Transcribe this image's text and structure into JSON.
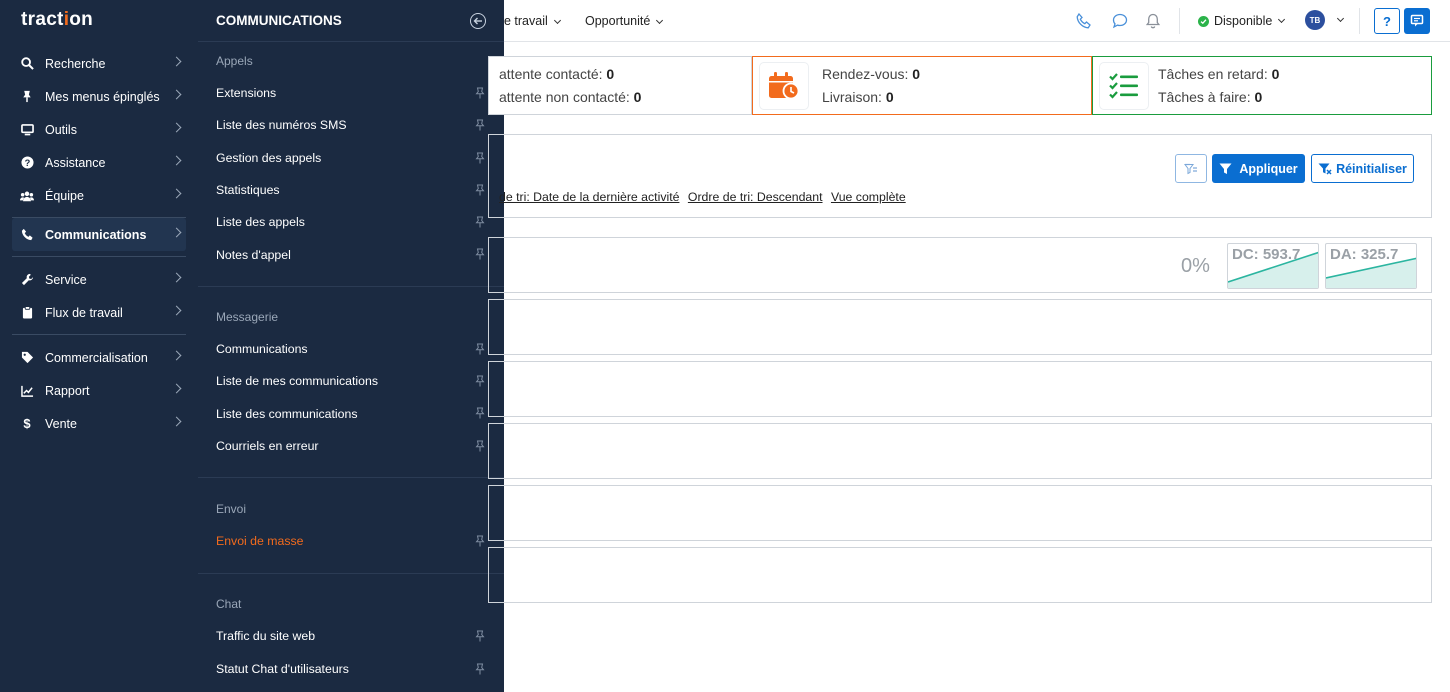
{
  "sidebar": {
    "logo_pre": "tract",
    "logo_dot": "i",
    "logo_post": "on",
    "items": [
      {
        "label": "Recherche",
        "icon": "search-icon"
      },
      {
        "label": "Mes menus épinglés",
        "icon": "pin-icon"
      },
      {
        "label": "Outils",
        "icon": "monitor-icon"
      },
      {
        "label": "Assistance",
        "icon": "help-circle-icon"
      },
      {
        "label": "Équipe",
        "icon": "team-icon"
      },
      {
        "label": "Communications",
        "icon": "phone-icon",
        "active": true
      },
      {
        "label": "Service",
        "icon": "wrench-icon"
      },
      {
        "label": "Flux de travail",
        "icon": "clipboard-icon"
      },
      {
        "label": "Commercialisation",
        "icon": "tag-icon"
      },
      {
        "label": "Rapport",
        "icon": "chart-line-icon"
      },
      {
        "label": "Vente",
        "icon": "dollar-icon"
      }
    ]
  },
  "flyout": {
    "title": "COMMUNICATIONS",
    "sections": [
      {
        "title": "Appels",
        "items": [
          "Extensions",
          "Liste des numéros SMS",
          "Gestion des appels",
          "Statistiques",
          "Liste des appels",
          "Notes d'appel"
        ]
      },
      {
        "title": "Messagerie",
        "items": [
          "Communications",
          "Liste de mes communications",
          "Liste des communications",
          "Courriels en erreur"
        ]
      },
      {
        "title": "Envoi",
        "items": [
          "Envoi de masse"
        ]
      },
      {
        "title": "Chat",
        "items": [
          "Traffic du site web",
          "Statut Chat d'utilisateurs"
        ]
      }
    ]
  },
  "topbar": {
    "menu_workflow": "e travail",
    "menu_opportunity": "Opportunité",
    "status": "Disponible",
    "help": "?",
    "avatar_initials": "TB"
  },
  "cards": {
    "c1_l1": "attente contacté:",
    "c1_v1": "0",
    "c1_l2": "attente non contacté:",
    "c1_v2": "0",
    "c2_l1": "Rendez-vous:",
    "c2_v1": "0",
    "c2_l2": "Livraison:",
    "c2_v2": "0",
    "c3_l1": "Tâches en retard:",
    "c3_v1": "0",
    "c3_l2": "Tâches à faire:",
    "c3_v2": "0"
  },
  "filters": {
    "apply": "Appliquer",
    "reset": "Réinitialiser",
    "sort_field": "de tri: Date de la dernière activité",
    "sort_order": "Ordre de tri: Descendant",
    "view": "Vue complète"
  },
  "stats": {
    "percent": "0%",
    "dc_label": "DC: 593.7",
    "da_label": "DA: 325.7"
  },
  "colors": {
    "sidebar_bg": "#1b2a41",
    "accent_blue": "#0a6ed1",
    "accent_orange": "#f26b1d",
    "accent_green": "#1a9c3e",
    "spark_teal": "#2bb5a0"
  }
}
